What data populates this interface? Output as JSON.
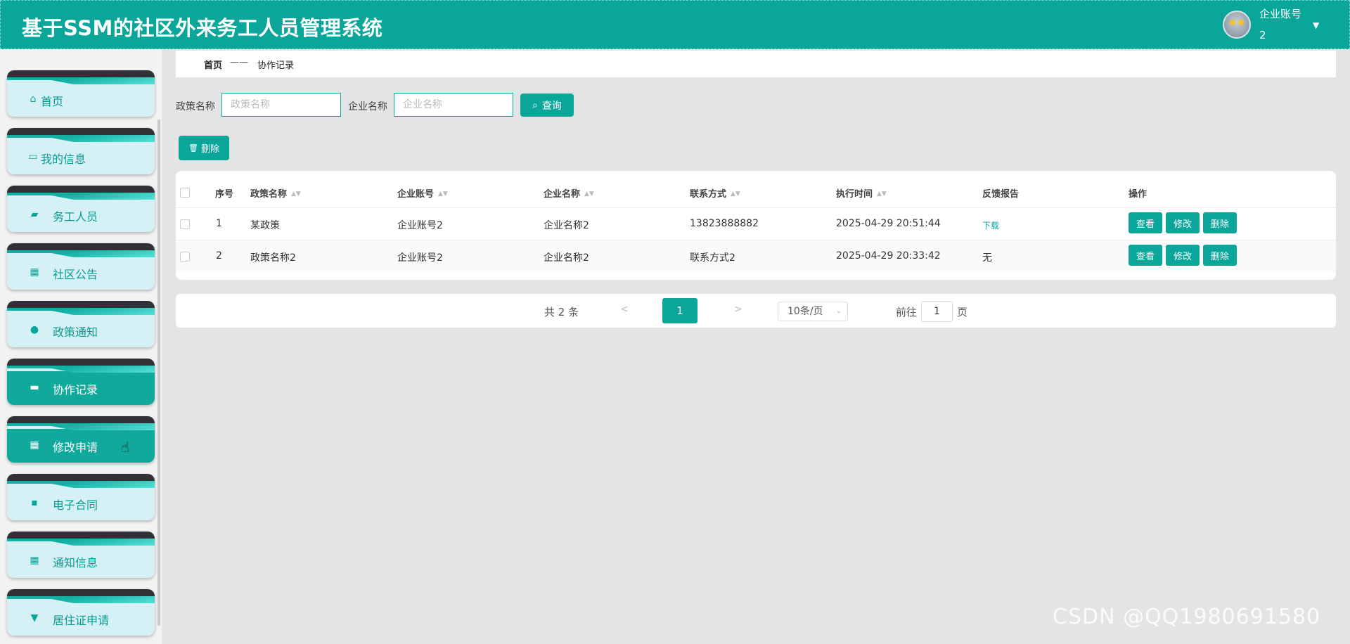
{
  "header": {
    "title": "基于SSM的社区外来务工人员管理系统",
    "user_role": "企业账号",
    "user_id": "2",
    "caret": "▼"
  },
  "sidebar": {
    "items": [
      {
        "label": "首页",
        "icon": "home-icon",
        "glyph": "⌂",
        "active": false
      },
      {
        "label": "我的信息",
        "icon": "id-card-icon",
        "glyph": "▭",
        "active": false
      },
      {
        "label": "务工人员",
        "icon": "ticket-icon",
        "glyph": "▰",
        "active": false
      },
      {
        "label": "社区公告",
        "icon": "grid-icon",
        "glyph": "▦",
        "active": false
      },
      {
        "label": "政策通知",
        "icon": "user-icon",
        "glyph": "●",
        "active": false
      },
      {
        "label": "协作记录",
        "icon": "briefcase-icon",
        "glyph": "▬",
        "active": true
      },
      {
        "label": "修改申请",
        "icon": "table-icon",
        "glyph": "▦",
        "active": true
      },
      {
        "label": "电子合同",
        "icon": "chat-icon",
        "glyph": "▪",
        "active": false
      },
      {
        "label": "通知信息",
        "icon": "grid-icon",
        "glyph": "▦",
        "active": false
      },
      {
        "label": "居住证申请",
        "icon": "stamp-icon",
        "glyph": "▼",
        "active": false
      }
    ]
  },
  "breadcrumb": {
    "home": "首页",
    "separator": "——",
    "current": "协作记录"
  },
  "search": {
    "policy_label": "政策名称",
    "policy_placeholder": "政策名称",
    "company_label": "企业名称",
    "company_placeholder": "企业名称",
    "query_button": "查询",
    "search_glyph": "⌕"
  },
  "toolbar": {
    "delete_button": "删除",
    "trash_glyph": "🗑"
  },
  "table": {
    "columns": [
      "序号",
      "政策名称",
      "企业账号",
      "企业名称",
      "联系方式",
      "执行时间",
      "反馈报告",
      "操作"
    ],
    "sort_glyph": "▲▼",
    "rows": [
      {
        "index": "1",
        "policy": "某政策",
        "account": "企业账号2",
        "company": "企业名称2",
        "contact": "13823888882",
        "time": "2025-04-29 20:51:44",
        "report": "下载"
      },
      {
        "index": "2",
        "policy": "政策名称2",
        "account": "企业账号2",
        "company": "企业名称2",
        "contact": "联系方式2",
        "time": "2025-04-29 20:33:42",
        "report": "无"
      }
    ],
    "actions": {
      "view": "查看",
      "edit": "修改",
      "delete": "删除"
    }
  },
  "pagination": {
    "total": "共 2 条",
    "prev": "<",
    "current_page": "1",
    "next": ">",
    "page_size": "10条/页",
    "size_caret": "⌄",
    "goto_label": "前往",
    "goto_value": "1",
    "goto_suffix": "页"
  },
  "watermark": "CSDN @QQ1980691580",
  "colors": {
    "accent": "#0aa69a",
    "sidebar_item_bg": "#d6f1f6",
    "background": "#e4e4e4"
  }
}
